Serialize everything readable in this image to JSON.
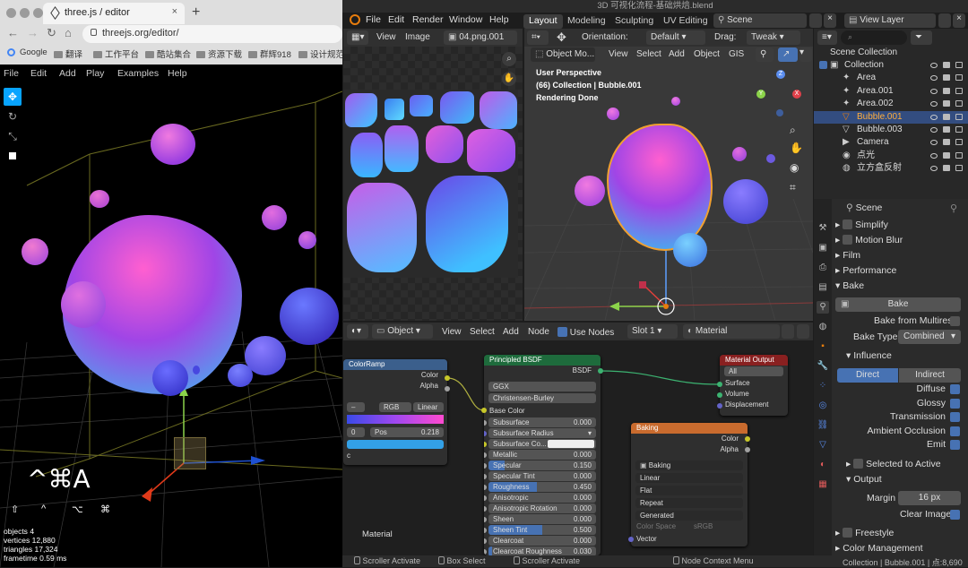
{
  "browser": {
    "tab_title": "three.js / editor",
    "url": "threejs.org/editor/",
    "bookmarks": [
      "Google",
      "翻译",
      "工作平台",
      "酷站集合",
      "资源下载",
      "群辉918",
      "设计规范"
    ],
    "menu": [
      "File",
      "Edit",
      "Add",
      "Play",
      "Examples",
      "Help"
    ],
    "shortcut": "^⌘A",
    "shortcut_keys": [
      "⇧",
      "^",
      "⌥",
      "⌘"
    ],
    "stats": {
      "objects_label": "objects",
      "objects": "4",
      "vertices_label": "vertices",
      "vertices": "12,880",
      "triangles_label": "triangles",
      "triangles": "17,324",
      "frametime_label": "frametime",
      "frametime": "0.59 ms"
    }
  },
  "blender": {
    "window_title": "3D 可视化流程-基础烘焙.blend",
    "menu": [
      "File",
      "Edit",
      "Render",
      "Window",
      "Help"
    ],
    "workspaces": [
      "Layout",
      "Modeling",
      "Sculpting",
      "UV Editing"
    ],
    "scene": "Scene",
    "view_layer": "View Layer",
    "image_editor": {
      "menu": [
        "View",
        "Image"
      ],
      "image": "04.png.001"
    },
    "viewport": {
      "mode": "Object Mo...",
      "orientation_label": "Orientation:",
      "orientation": "Default",
      "drag_label": "Drag:",
      "drag": "Tweak",
      "menu": [
        "View",
        "Select",
        "Add",
        "Object",
        "GIS"
      ],
      "overlay": [
        "User Perspective",
        "(66) Collection | Bubble.001",
        "Rendering Done"
      ],
      "gizmo": {
        "x": "X",
        "y": "Y",
        "z": "Z"
      }
    },
    "outliner": {
      "title": "Scene Collection",
      "items": [
        {
          "name": "Collection",
          "active": false
        },
        {
          "name": "Area",
          "active": false
        },
        {
          "name": "Area.001",
          "active": false
        },
        {
          "name": "Area.002",
          "active": false
        },
        {
          "name": "Bubble.001",
          "active": true
        },
        {
          "name": "Bubble.003",
          "active": false
        },
        {
          "name": "Camera",
          "active": false
        },
        {
          "name": "点光",
          "active": false
        },
        {
          "name": "立方盒反射",
          "active": false
        }
      ]
    },
    "node_editor": {
      "type": "Object",
      "menu": [
        "View",
        "Select",
        "Add",
        "Node"
      ],
      "use_nodes": "Use Nodes",
      "slot": "Slot 1",
      "material": "Material",
      "frame_label": "Material",
      "colorramp": {
        "title": "ColorRamp",
        "outputs": [
          "Color",
          "Alpha"
        ],
        "mode": "RGB",
        "interp": "Linear",
        "index": "0",
        "pos_label": "Pos",
        "pos": "0.218",
        "fac": "c"
      },
      "bsdf": {
        "title": "Principled BSDF",
        "output": "BSDF",
        "dist": "GGX",
        "sss": "Christensen-Burley",
        "base_color": "Base Color",
        "fields": [
          {
            "label": "Subsurface",
            "value": "0.000",
            "fill": 0
          },
          {
            "label": "Subsurface Radius",
            "value": "",
            "fill": 0
          },
          {
            "label": "Subsurface Co...",
            "value": "",
            "fill": 0
          },
          {
            "label": "Metallic",
            "value": "0.000",
            "fill": 0
          },
          {
            "label": "Specular",
            "value": "0.150",
            "fill": 0.15
          },
          {
            "label": "Specular Tint",
            "value": "0.000",
            "fill": 0
          },
          {
            "label": "Roughness",
            "value": "0.450",
            "fill": 0.45
          },
          {
            "label": "Anisotropic",
            "value": "0.000",
            "fill": 0
          },
          {
            "label": "Anisotropic Rotation",
            "value": "0.000",
            "fill": 0
          },
          {
            "label": "Sheen",
            "value": "0.000",
            "fill": 0
          },
          {
            "label": "Sheen Tint",
            "value": "0.500",
            "fill": 0.5
          },
          {
            "label": "Clearcoat",
            "value": "0.000",
            "fill": 0
          },
          {
            "label": "Clearcoat Roughness",
            "value": "0.030",
            "fill": 0.03
          }
        ]
      },
      "output": {
        "title": "Material Output",
        "target": "All",
        "inputs": [
          "Surface",
          "Volume",
          "Displacement"
        ]
      },
      "baking": {
        "title": "Baking",
        "outputs": [
          "Color",
          "Alpha"
        ],
        "image": "Baking",
        "opts": [
          "Linear",
          "Flat",
          "Repeat",
          "Generated"
        ],
        "colorspace_label": "Color Space",
        "colorspace": "sRGB",
        "vector": "Vector"
      }
    },
    "properties": {
      "title": "Scene",
      "panels": [
        "Simplify",
        "Motion Blur",
        "Film",
        "Performance",
        "Bake"
      ],
      "bake_button": "Bake",
      "bake_multires": "Bake from Multires",
      "bake_type_label": "Bake Type",
      "bake_type": "Combined",
      "influence": "Influence",
      "direct": "Direct",
      "indirect": "Indirect",
      "toggles": [
        "Diffuse",
        "Glossy",
        "Transmission",
        "Ambient Occlusion",
        "Emit"
      ],
      "selected_to_active": "Selected to Active",
      "output": "Output",
      "margin_label": "Margin",
      "margin": "16 px",
      "clear_image": "Clear Image",
      "freestyle": "Freestyle",
      "color_management": "Color Management"
    },
    "status": {
      "items": [
        "Scroller Activate",
        "Box Select",
        "Scroller Activate",
        "Node Context Menu"
      ],
      "right": "Collection | Bubble.001 | 点:8,690"
    }
  },
  "colors": {
    "accent": "#4772b3",
    "node_bsdf": "#1e6b3c",
    "node_output": "#892020",
    "node_image": "#c96b2e",
    "node_colorramp": "#3b5f8c"
  }
}
